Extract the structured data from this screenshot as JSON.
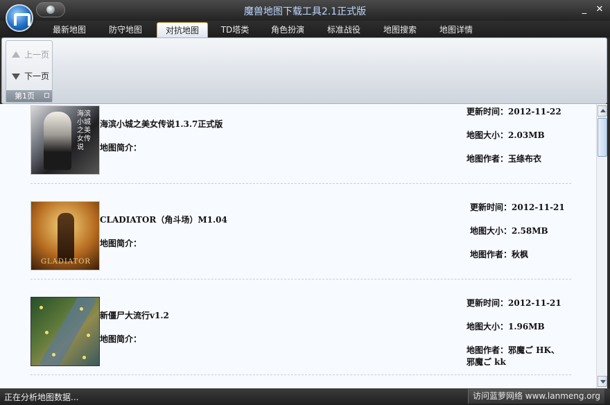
{
  "window": {
    "title": "魔兽地图下载工具2.1正式版",
    "minimize_icon": "minimize-icon",
    "close_icon": "close-icon"
  },
  "tabs": [
    {
      "label": "最新地图"
    },
    {
      "label": "防守地图"
    },
    {
      "label": "对抗地图",
      "active": true
    },
    {
      "label": "TD塔类"
    },
    {
      "label": "角色扮演"
    },
    {
      "label": "标准战役"
    },
    {
      "label": "地图搜索"
    },
    {
      "label": "地图详情"
    }
  ],
  "ribbon": {
    "prev_label": "上一页",
    "next_label": "下一页",
    "group_label": "第1页"
  },
  "maps": [
    {
      "name": "海滨小城之美女传说1.3.7正式版",
      "intro_label": "地图简介：",
      "updated": "更新时间：2012-11-22",
      "size": "地图大小：2.03MB",
      "author": "地图作者：玉绦布衣",
      "thumb_text": "海滨小城之美女传说"
    },
    {
      "name": "CLADIATOR（角斗场）M1.04",
      "intro_label": "地图简介：",
      "updated": "更新时间：2012-11-21",
      "size": "地图大小：2.58MB",
      "author": "地图作者：秋枫",
      "thumb_text": "GLADIATOR"
    },
    {
      "name": "新僵尸大流行v1.2",
      "intro_label": "地图简介：",
      "updated": "更新时间：2012-11-21",
      "size": "地图大小：1.96MB",
      "author": "地图作者：邪魔ご HK、",
      "author_line2": "邪魔ご kk"
    }
  ],
  "status": {
    "text": "正在分析地图数据...",
    "link": "访问蓝萝网络 www.lanmeng.org"
  }
}
